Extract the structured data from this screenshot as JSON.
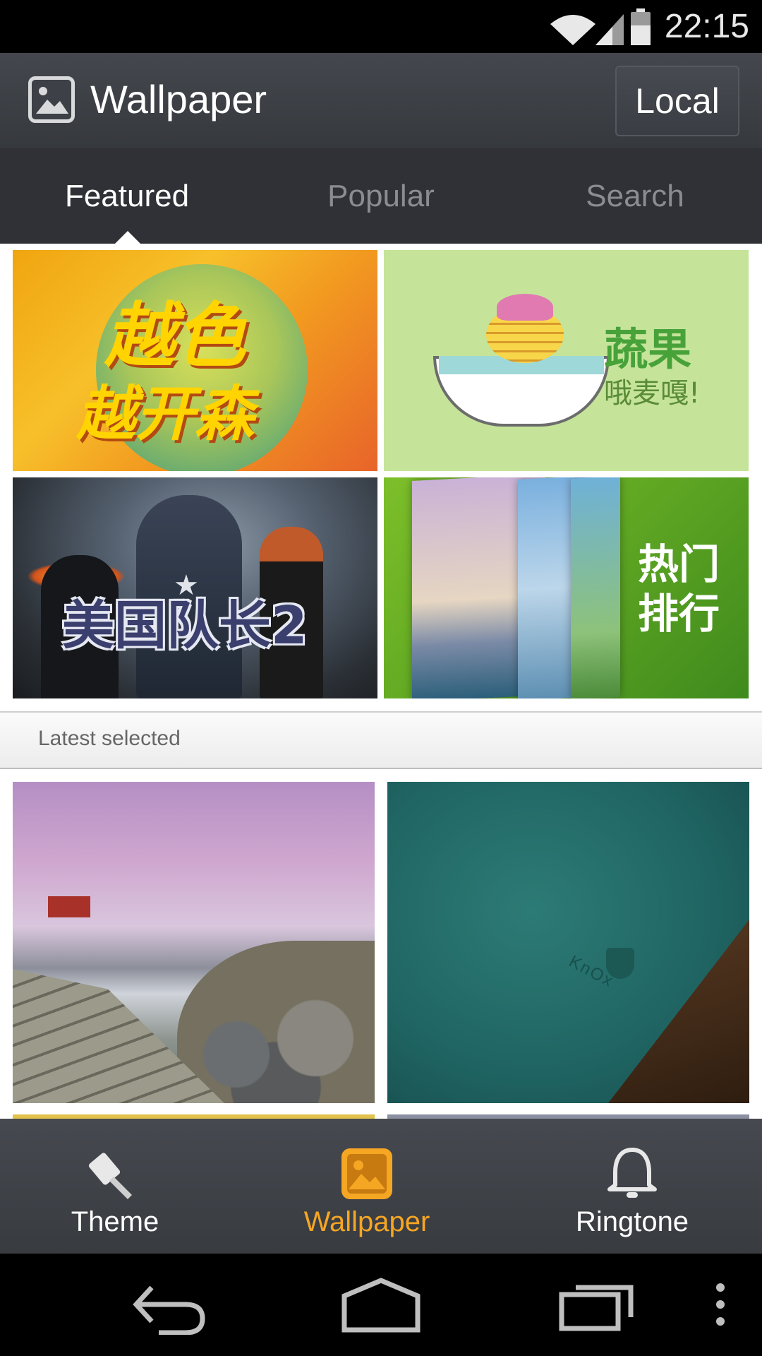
{
  "status_bar": {
    "time": "22:15",
    "icons": [
      "wifi-icon",
      "signal-icon",
      "battery-icon"
    ]
  },
  "app_bar": {
    "icon": "image-icon",
    "title": "Wallpaper",
    "local_button": "Local"
  },
  "tabs": [
    {
      "label": "Featured",
      "active": true
    },
    {
      "label": "Popular",
      "active": false
    },
    {
      "label": "Search",
      "active": false
    }
  ],
  "featured": [
    {
      "lines": [
        "越色",
        "越开森"
      ]
    },
    {
      "title": "蔬果",
      "subtitle": "哦麦嘎!"
    },
    {
      "title": "美国队长2"
    },
    {
      "lines": [
        "热门",
        "排行"
      ]
    }
  ],
  "section": {
    "label": "Latest selected"
  },
  "latest": [
    {
      "name": "lake-dock-wallpaper"
    },
    {
      "name": "knox-teal-wallpaper",
      "mark": "KnOx"
    }
  ],
  "bottom_nav": [
    {
      "label": "Theme",
      "icon": "brush-icon",
      "active": false
    },
    {
      "label": "Wallpaper",
      "icon": "image-icon",
      "active": true
    },
    {
      "label": "Ringtone",
      "icon": "bell-icon",
      "active": false
    }
  ],
  "system_nav": [
    "back-icon",
    "home-icon",
    "recents-icon",
    "menu-icon"
  ],
  "colors": {
    "accent": "#f5a623",
    "app_bar": "#3d4046",
    "tab_bar": "#2f3136"
  }
}
